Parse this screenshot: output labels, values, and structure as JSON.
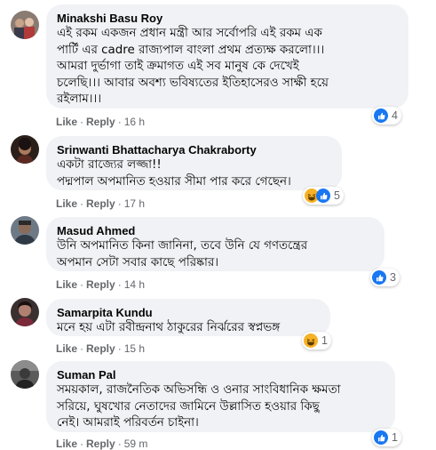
{
  "comments": [
    {
      "name": "Minakshi Basu Roy",
      "lines": [
        "এই রকম একজন প্রধান মন্ত্রী আর সর্বোপরি এই রকম এক",
        "পার্টি এর cadre রাজ্যপাল বাংলা প্রথম প্রত্যক্ষ করলো।।।",
        "আমরা দুর্ভাগা তাই ক্রমাগত এই সব মানুষ কে দেখেই",
        "চলেছি।।। আবার অবশ্য ভবিষ্যতের ইতিহাসেরও সাক্ষী হয়ে",
        "রইলাম।।।"
      ],
      "like_label": "Like",
      "reply_label": "Reply",
      "time": "16 h",
      "reactions": [
        "like"
      ],
      "reaction_count": "4"
    },
    {
      "name": "Srinwanti Bhattacharya Chakraborty",
      "lines": [
        "একটা রাজ্যের লজ্জা!!",
        "পদ্মপাল অপমানিত হওয়ার সীমা পার করে গেছেন।"
      ],
      "like_label": "Like",
      "reply_label": "Reply",
      "time": "17 h",
      "reactions": [
        "haha",
        "like"
      ],
      "reaction_count": "5"
    },
    {
      "name": "Masud Ahmed",
      "lines": [
        "উনি অপমানিত কিনা জানিনা, তবে উনি যে গণতন্ত্রের",
        "অপমান সেটা সবার কাছে পরিষ্কার।"
      ],
      "like_label": "Like",
      "reply_label": "Reply",
      "time": "14 h",
      "reactions": [
        "like"
      ],
      "reaction_count": "3"
    },
    {
      "name": "Samarpita Kundu",
      "lines": [
        "মনে হয় এটা রবীন্দ্রনাথ ঠাকুরের নির্ঝরের স্বপ্নভঙ্গ"
      ],
      "like_label": "Like",
      "reply_label": "Reply",
      "time": "15 h",
      "reactions": [
        "haha"
      ],
      "reaction_count": "1"
    },
    {
      "name": "Suman Pal",
      "lines": [
        "সময়কাল, রাজনৈতিক অভিসন্ধি ও ওনার সাংবিধানিক ক্ষমতা",
        "সরিয়ে, ঘুষখোর নেতাদের জামিনে উল্লাসিত হওয়ার কিছু",
        "নেই। আমরাই পরিবর্তন চাইনা।"
      ],
      "like_label": "Like",
      "reply_label": "Reply",
      "time": "59 m",
      "reactions": [
        "like"
      ],
      "reaction_count": "1"
    }
  ]
}
